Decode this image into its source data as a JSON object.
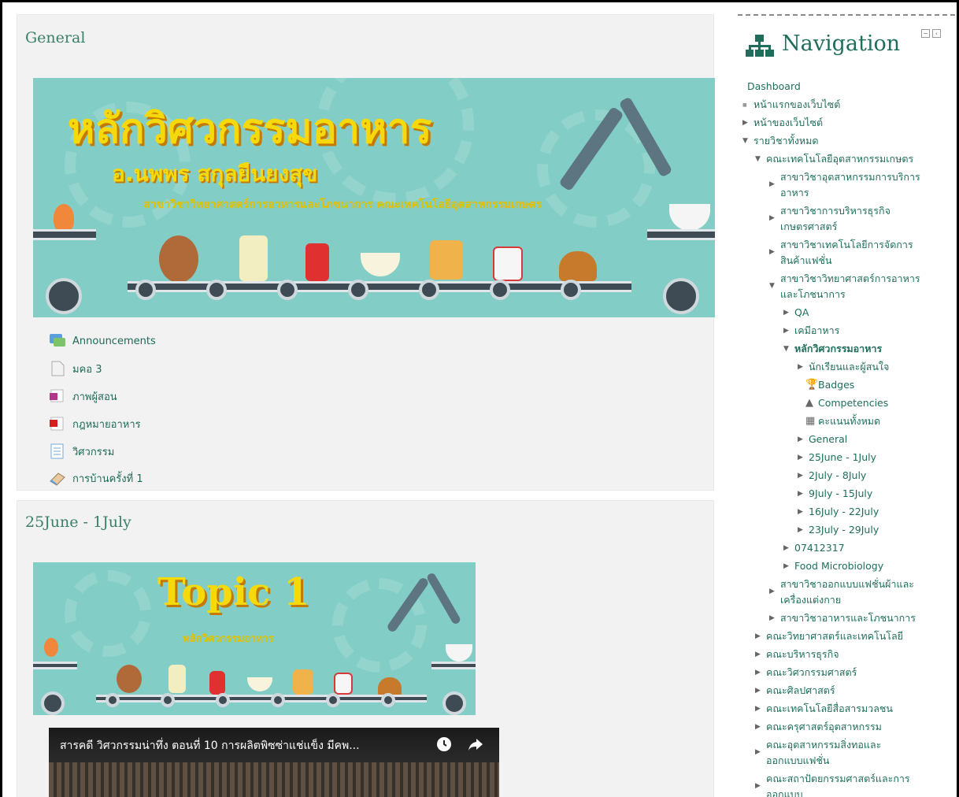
{
  "sections": [
    {
      "title": "General",
      "banner": {
        "title": "หลักวิศวกรรมอาหาร",
        "teacher": "อ.นพพร สกุลยืนยงสุข",
        "department": "สาขาวิชาวิทยาศาสตร์การอาหารและโภชนาการ คณะเทคโนโลยีอุตสาหกรรมเกษตร"
      },
      "activities": [
        {
          "label": "Announcements",
          "icon": "forum-icon"
        },
        {
          "label": "มคอ 3",
          "icon": "file-icon"
        },
        {
          "label": "ภาพผู้สอน",
          "icon": "image-icon"
        },
        {
          "label": "กฎหมายอาหาร",
          "icon": "pdf-icon"
        },
        {
          "label": "วิศวกรรม",
          "icon": "page-icon"
        },
        {
          "label": "การบ้านครั้งที่ 1",
          "icon": "assignment-icon"
        }
      ]
    },
    {
      "title": "25June - 1July",
      "banner": {
        "title": "Topic 1",
        "subtitle": "หลักวิศวกรรมอาหาร"
      },
      "video": {
        "title": "สารคดี วิศวกรรมน่าทึ่ง ตอนที่ 10 การผลิตพิซซ่าแช่แข็ง มีคพ..."
      }
    }
  ],
  "navigation": {
    "title": "Navigation",
    "items": [
      {
        "label": "Dashboard",
        "depth": 0,
        "marker": "none"
      },
      {
        "label": "หน้าแรกของเว็บไซต์",
        "depth": 1,
        "marker": "bullet"
      },
      {
        "label": "หน้าของเว็บไซต์",
        "depth": 1,
        "marker": "collapsed"
      },
      {
        "label": "รายวิชาทั้งหมด",
        "depth": 1,
        "marker": "expanded"
      },
      {
        "label": "คณะเทคโนโลยีอุตสาหกรรมเกษตร",
        "depth": 2,
        "marker": "expanded"
      },
      {
        "label": "สาขาวิชาอุตสาหกรรมการบริการ",
        "label2": "อาหาร",
        "depth": 3,
        "marker": "collapsed"
      },
      {
        "label": "สาขาวิชาการบริหารธุรกิจ",
        "label2": "เกษตรศาสตร์",
        "depth": 3,
        "marker": "collapsed"
      },
      {
        "label": "สาขาวิชาเทคโนโลยีการจัดการ",
        "label2": "สินค้าแฟชั่น",
        "depth": 3,
        "marker": "collapsed"
      },
      {
        "label": "สาขาวิชาวิทยาศาสตร์การอาหาร",
        "label2": "และโภชนาการ",
        "depth": 3,
        "marker": "expanded"
      },
      {
        "label": "QA",
        "depth": 4,
        "marker": "collapsed"
      },
      {
        "label": "เคมีอาหาร",
        "depth": 4,
        "marker": "collapsed"
      },
      {
        "label": "หลักวิศวกรรมอาหาร",
        "depth": 4,
        "marker": "expanded",
        "bold": true
      },
      {
        "label": "นักเรียนและผู้สนใจ",
        "depth": 5,
        "marker": "collapsed"
      },
      {
        "label": "Badges",
        "depth": 5,
        "marker": "badge-icon"
      },
      {
        "label": "Competencies",
        "depth": 5,
        "marker": "competency-icon"
      },
      {
        "label": "คะแนนทั้งหมด",
        "depth": 5,
        "marker": "grades-icon"
      },
      {
        "label": "General",
        "depth": 5,
        "marker": "collapsed"
      },
      {
        "label": "25June - 1July",
        "depth": 5,
        "marker": "collapsed"
      },
      {
        "label": "2July - 8July",
        "depth": 5,
        "marker": "collapsed"
      },
      {
        "label": "9July - 15July",
        "depth": 5,
        "marker": "collapsed"
      },
      {
        "label": "16July - 22July",
        "depth": 5,
        "marker": "collapsed"
      },
      {
        "label": "23July - 29July",
        "depth": 5,
        "marker": "collapsed"
      },
      {
        "label": "07412317",
        "depth": 4,
        "marker": "collapsed"
      },
      {
        "label": "Food Microbiology",
        "depth": 4,
        "marker": "collapsed"
      },
      {
        "label": "สาขาวิชาออกแบบแฟชั่นผ้าและ",
        "label2": "เครื่องแต่งกาย",
        "depth": 3,
        "marker": "collapsed"
      },
      {
        "label": "สาขาวิชาอาหารและโภชนาการ",
        "depth": 3,
        "marker": "collapsed"
      },
      {
        "label": "คณะวิทยาศาสตร์และเทคโนโลยี",
        "depth": 2,
        "marker": "collapsed"
      },
      {
        "label": "คณะบริหารธุรกิจ",
        "depth": 2,
        "marker": "collapsed"
      },
      {
        "label": "คณะวิศวกรรมศาสตร์",
        "depth": 2,
        "marker": "collapsed"
      },
      {
        "label": "คณะศิลปศาสตร์",
        "depth": 2,
        "marker": "collapsed"
      },
      {
        "label": "คณะเทคโนโลยีสื่อสารมวลชน",
        "depth": 2,
        "marker": "collapsed"
      },
      {
        "label": "คณะครุศาสตร์อุตสาหกรรม",
        "depth": 2,
        "marker": "collapsed"
      },
      {
        "label": "คณะอุตสาหกรรมสิ่งทอและ",
        "label2": "ออกแบบแฟชั่น",
        "depth": 2,
        "marker": "collapsed"
      },
      {
        "label": "คณะสถาปัตยกรรมศาสตร์และการ",
        "label2": "ออกแบบ",
        "depth": 2,
        "marker": "collapsed"
      }
    ]
  },
  "colors": {
    "link": "#1f6e5c",
    "section_bg": "#f2f2f2",
    "banner_bg": "#82cdc5",
    "banner_title": "#f5d90a"
  }
}
